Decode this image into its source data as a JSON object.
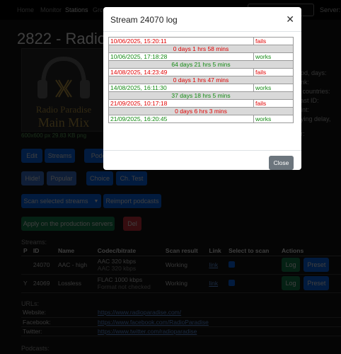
{
  "nav": {
    "items": [
      "Home",
      "Monitor",
      "Stations",
      "Gro"
    ],
    "server_label": "Server:"
  },
  "station": {
    "title": "2822 - Radio",
    "logo_line1": "Radio Paradise",
    "logo_line2": "Main Mix",
    "logo_caption": "600x600 px 29.83 KB png"
  },
  "buttons": {
    "edit": "Edit",
    "streams": "Streams",
    "podc": "Podc",
    "hide": "Hide!",
    "popular": "Popular",
    "choice": "Choice",
    "ch_test": "Ch. Test",
    "scan_selected": "Scan selected streams",
    "reimport": "Reimport podcasts",
    "apply": "Apply on the production servers",
    "del": "Del"
  },
  "side_info": [
    ":",
    "riod, days:",
    "ank:",
    "d countries:",
    "cast ID:",
    "oint:",
    "aying delay,",
    "er:"
  ],
  "streams": {
    "label": "Streams:",
    "headers": [
      "P",
      "ID",
      "Name",
      "Codec/bitrate",
      "Scan result",
      "Link",
      "Select to scan",
      "Actions"
    ],
    "rows": [
      {
        "p": "",
        "id": "24070",
        "name": "AAC - high",
        "codec": "AAC 320 kbps",
        "codec_sub": "AAC 320 kbps",
        "result": "Working",
        "link": "link",
        "log": "Log",
        "preset": "Preset"
      },
      {
        "p": "Y",
        "id": "24069",
        "name": "Lossless",
        "codec": "FLAC 1000 kbps",
        "codec_sub": "Format not checked",
        "result": "Working",
        "link": "link",
        "log": "Log",
        "preset": "Preset"
      }
    ]
  },
  "urls": {
    "label": "URLs:",
    "rows": [
      {
        "k": "Website:",
        "v": "https://www.radioparadise.com/"
      },
      {
        "k": "Facebook:",
        "v": "https://www.facebook.com/RadioParadise"
      },
      {
        "k": "Twitter:",
        "v": "https://www.twitter.com/radioparadise"
      }
    ]
  },
  "podcasts_label": "Podcasts:",
  "modal": {
    "title": "Stream 24070 log",
    "close_label": "Close",
    "entries": [
      {
        "type": "event",
        "time": "10/06/2025, 15:20:11",
        "status": "fails"
      },
      {
        "type": "gap",
        "text": "0 days 1 hrs 58 mins",
        "status": "fails"
      },
      {
        "type": "event",
        "time": "10/06/2025, 17:18:28",
        "status": "works"
      },
      {
        "type": "gap",
        "text": "64 days 21 hrs 5 mins",
        "status": "works"
      },
      {
        "type": "event",
        "time": "14/08/2025, 14:23:49",
        "status": "fails"
      },
      {
        "type": "gap",
        "text": "0 days 1 hrs 47 mins",
        "status": "fails"
      },
      {
        "type": "event",
        "time": "14/08/2025, 16:11:30",
        "status": "works"
      },
      {
        "type": "gap",
        "text": "37 days 18 hrs 5 mins",
        "status": "works"
      },
      {
        "type": "event",
        "time": "21/09/2025, 10:17:18",
        "status": "fails"
      },
      {
        "type": "gap",
        "text": "0 days 6 hrs 3 mins",
        "status": "fails"
      },
      {
        "type": "event",
        "time": "21/09/2025, 16:20:45",
        "status": "works"
      }
    ]
  },
  "colors": {
    "fails": "#e00000",
    "works": "#138a13",
    "primary": "#0d6efd"
  }
}
